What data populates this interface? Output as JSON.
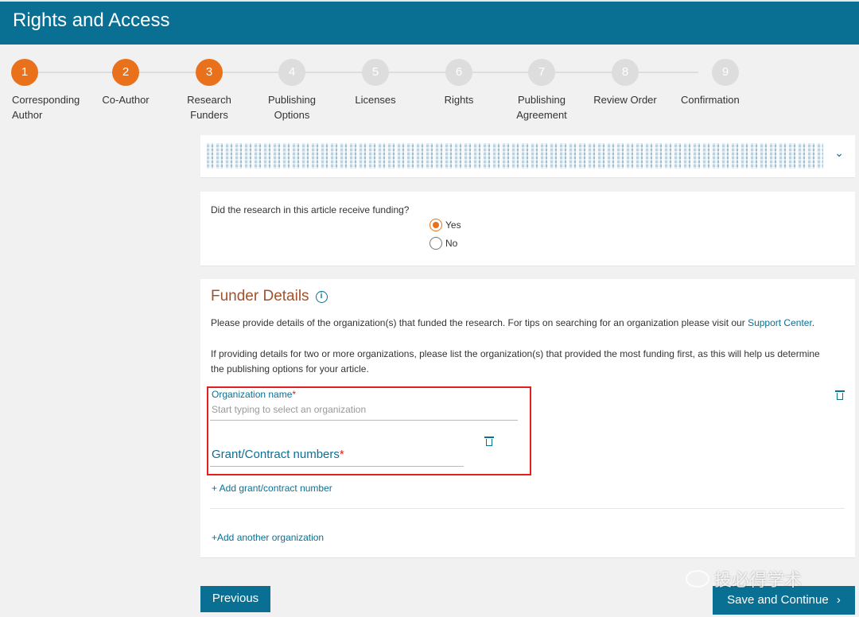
{
  "header": {
    "title": "Rights and Access"
  },
  "steps": [
    {
      "number": "1",
      "label": "Corresponding\nAuthor",
      "state": "done"
    },
    {
      "number": "2",
      "label": "Co-Author",
      "state": "done"
    },
    {
      "number": "3",
      "label": "Research\nFunders",
      "state": "done"
    },
    {
      "number": "4",
      "label": "Publishing\nOptions",
      "state": "todo"
    },
    {
      "number": "5",
      "label": "Licenses",
      "state": "todo"
    },
    {
      "number": "6",
      "label": "Rights",
      "state": "todo"
    },
    {
      "number": "7",
      "label": "Publishing\nAgreement",
      "state": "todo"
    },
    {
      "number": "8",
      "label": "Review Order",
      "state": "todo"
    },
    {
      "number": "9",
      "label": "Confirmation",
      "state": "todo"
    }
  ],
  "article": {
    "expand_icon": "chevron-down-icon"
  },
  "funding": {
    "question": "Did the research in this article receive funding?",
    "options": [
      {
        "label": "Yes",
        "checked": true
      },
      {
        "label": "No",
        "checked": false
      }
    ]
  },
  "funder": {
    "title": "Funder Details",
    "intro_before_link": "Please provide details of the organization(s) that funded the research. For tips on searching for an organization please visit our ",
    "intro_link": "Support Center",
    "intro_after_link": ".",
    "note": "If providing details for two or more organizations, please list the organization(s) that provided the most funding first, as this will help us determine the publishing options for your article.",
    "org_label": "Organization name",
    "org_placeholder": "Start typing to select an organization",
    "grant_label": "Grant/Contract numbers",
    "required_mark": "*",
    "add_grant": "+ Add grant/contract number",
    "add_org": "+Add another organization"
  },
  "buttons": {
    "previous": "Previous",
    "save": "Save and Continue",
    "save_icon": "chevron-right-icon"
  },
  "watermark": {
    "text": "投必得学术"
  },
  "colors": {
    "brand": "#0a7093",
    "accent": "#e9711c",
    "highlight": "#e02020"
  }
}
